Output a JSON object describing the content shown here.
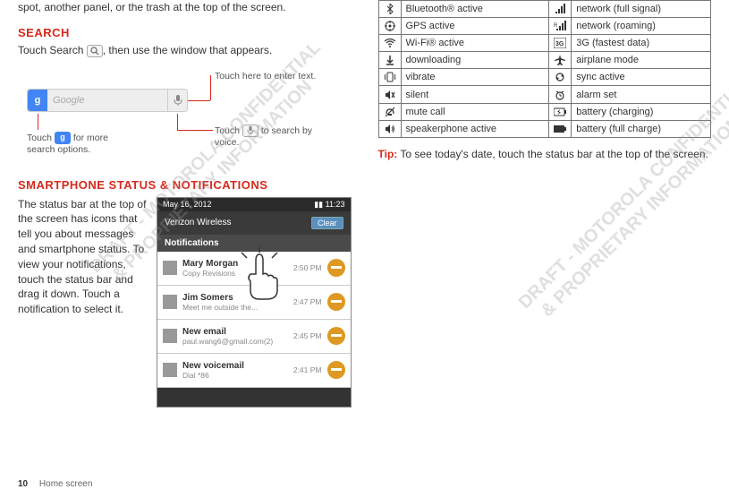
{
  "intro_fragment": "spot, another panel, or the trash at the top of the screen.",
  "search": {
    "heading": "SEARCH",
    "instruction_pre": "Touch Search ",
    "instruction_post": ", then use the window that appears.",
    "placeholder": "Google",
    "callout_top": "Touch here to enter text.",
    "callout_left_pre": "Touch ",
    "callout_left_post": " for more search options.",
    "callout_right_pre": "Touch ",
    "callout_right_post": " to search by voice."
  },
  "notifications": {
    "heading": "SMARTPHONE STATUS & NOTIFICATIONS",
    "body": "The status bar at the top of the screen has icons that tell you about messages and smartphone status. To view your notifications, touch the status bar and drag it down. Touch a notification to select it.",
    "phone": {
      "date": "May 16, 2012",
      "time": "11:23",
      "carrier": "Verizon Wireless",
      "clear": "Clear",
      "section_label": "Notifications",
      "items": [
        {
          "title": "Mary Morgan",
          "sub": "Copy Revisions",
          "time": "2:50 PM"
        },
        {
          "title": "Jim Somers",
          "sub": "Meet me outside the...",
          "time": "2:47 PM"
        },
        {
          "title": "New email",
          "sub": "paul.wang6@gmail.com(2)",
          "time": "2:45 PM"
        },
        {
          "title": "New voicemail",
          "sub": "Dial *86",
          "time": "2:41 PM"
        }
      ]
    }
  },
  "icon_table": [
    {
      "left_icon": "bluetooth",
      "left_label": "Bluetooth® active",
      "right_icon": "signal",
      "right_label": "network (full signal)"
    },
    {
      "left_icon": "gps",
      "left_label": "GPS active",
      "right_icon": "roaming",
      "right_label": "network (roaming)"
    },
    {
      "left_icon": "wifi",
      "left_label": "Wi-Fi® active",
      "right_icon": "3g",
      "right_label": "3G (fastest data)"
    },
    {
      "left_icon": "download",
      "left_label": "downloading",
      "right_icon": "airplane",
      "right_label": "airplane mode"
    },
    {
      "left_icon": "vibrate",
      "left_label": "vibrate",
      "right_icon": "sync",
      "right_label": "sync active"
    },
    {
      "left_icon": "silent",
      "left_label": "silent",
      "right_icon": "alarm",
      "right_label": "alarm set"
    },
    {
      "left_icon": "mute",
      "left_label": "mute call",
      "right_icon": "charging",
      "right_label": "battery (charging)"
    },
    {
      "left_icon": "speaker",
      "left_label": "speakerphone active",
      "right_icon": "battery",
      "right_label": "battery (full charge)"
    }
  ],
  "tip": {
    "label": "Tip:",
    "text": " To see today's date, touch the status bar at the top of the screen."
  },
  "watermark": "DRAFT - MOTOROLA CONFIDENTIAL\n  & PROPRIETARY INFORMATION",
  "footer": {
    "page": "10",
    "section": "Home screen"
  }
}
